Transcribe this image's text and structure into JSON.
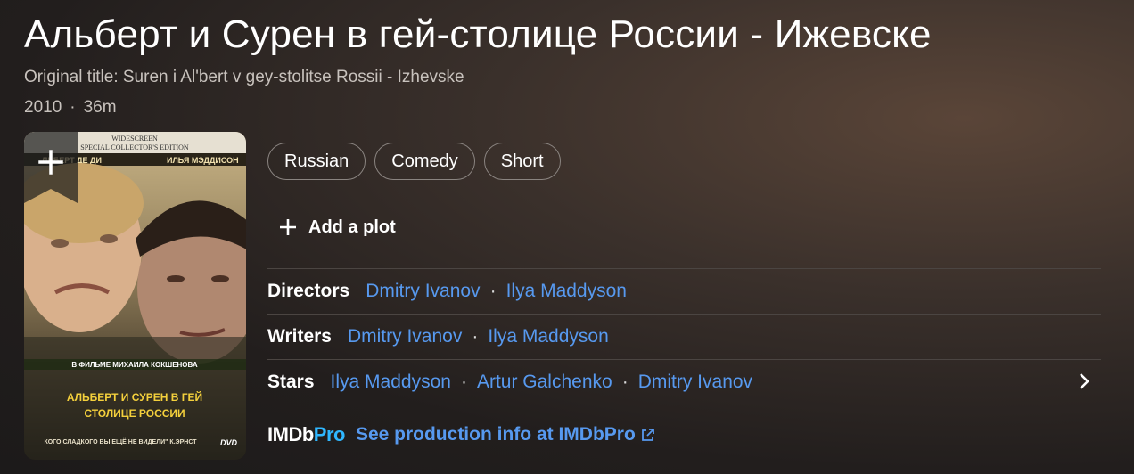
{
  "title": "Альберт и Сурен в гей-столице России - Ижевске",
  "original_title": "Original title: Suren i Al'bert v gey-stolitse Rossii - Izhevske",
  "meta": {
    "year": "2010",
    "separator": "·",
    "runtime": "36m"
  },
  "poster": {
    "top_line1": "WIDESCREEN",
    "top_line2": "SPECIAL COLLECTOR'S EDITION",
    "actor_left": "ЛЬБЕРТ ДЕ ДИ",
    "actor_right": "ИЛЬЯ МЭДДИСОН",
    "film_by": "В ФИЛЬМЕ МИХАИЛА КОКШЕНОВА",
    "poster_title1": "АЛЬБЕРТ И СУРЕН В ГЕЙ",
    "poster_title2": "СТОЛИЦЕ РОССИИ",
    "tagline": "КОГО СЛАДКОГО ВЫ ЕЩЁ НЕ ВИДЕЛИ\" К.ЭРНСТ",
    "dvd": "DVD"
  },
  "chips": [
    "Russian",
    "Comedy",
    "Short"
  ],
  "add_plot_label": "Add a plot",
  "credits": {
    "directors": {
      "label": "Directors",
      "names": [
        "Dmitry Ivanov",
        "Ilya Maddyson"
      ]
    },
    "writers": {
      "label": "Writers",
      "names": [
        "Dmitry Ivanov",
        "Ilya Maddyson"
      ]
    },
    "stars": {
      "label": "Stars",
      "names": [
        "Ilya Maddyson",
        "Artur Galchenko",
        "Dmitry Ivanov"
      ]
    }
  },
  "imdbpro": {
    "logo_main": "IMDb",
    "logo_pro": "Pro",
    "link_text": "See production info at IMDbPro"
  },
  "colors": {
    "link": "#5799ef",
    "pro_accent": "#2fb7ff"
  }
}
